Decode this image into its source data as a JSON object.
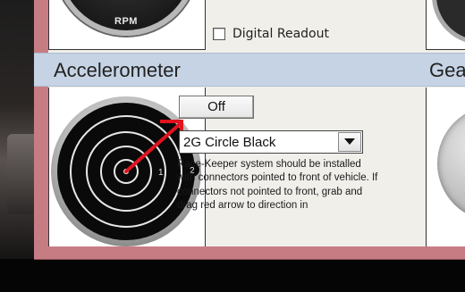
{
  "gauge_top_left": {
    "label": "RPM"
  },
  "digital_readout": {
    "label": "Digital Readout",
    "checked": false
  },
  "sections": {
    "accelerometer": "Accelerometer",
    "next_section_partial": "Gea"
  },
  "accelerometer": {
    "ring_labels": [
      "1",
      "2"
    ],
    "off_button": "Off",
    "style_select": {
      "value": "2G Circle Black"
    },
    "description": "Race-Keeper system should be installed with connectors pointed to front of vehicle.  If connectors not pointed to front, grab and drag red arrow to direction in"
  },
  "colors": {
    "panel_frame": "#c77c84",
    "section_bar": "#c5d3e4",
    "arrow": "#e0141e"
  }
}
